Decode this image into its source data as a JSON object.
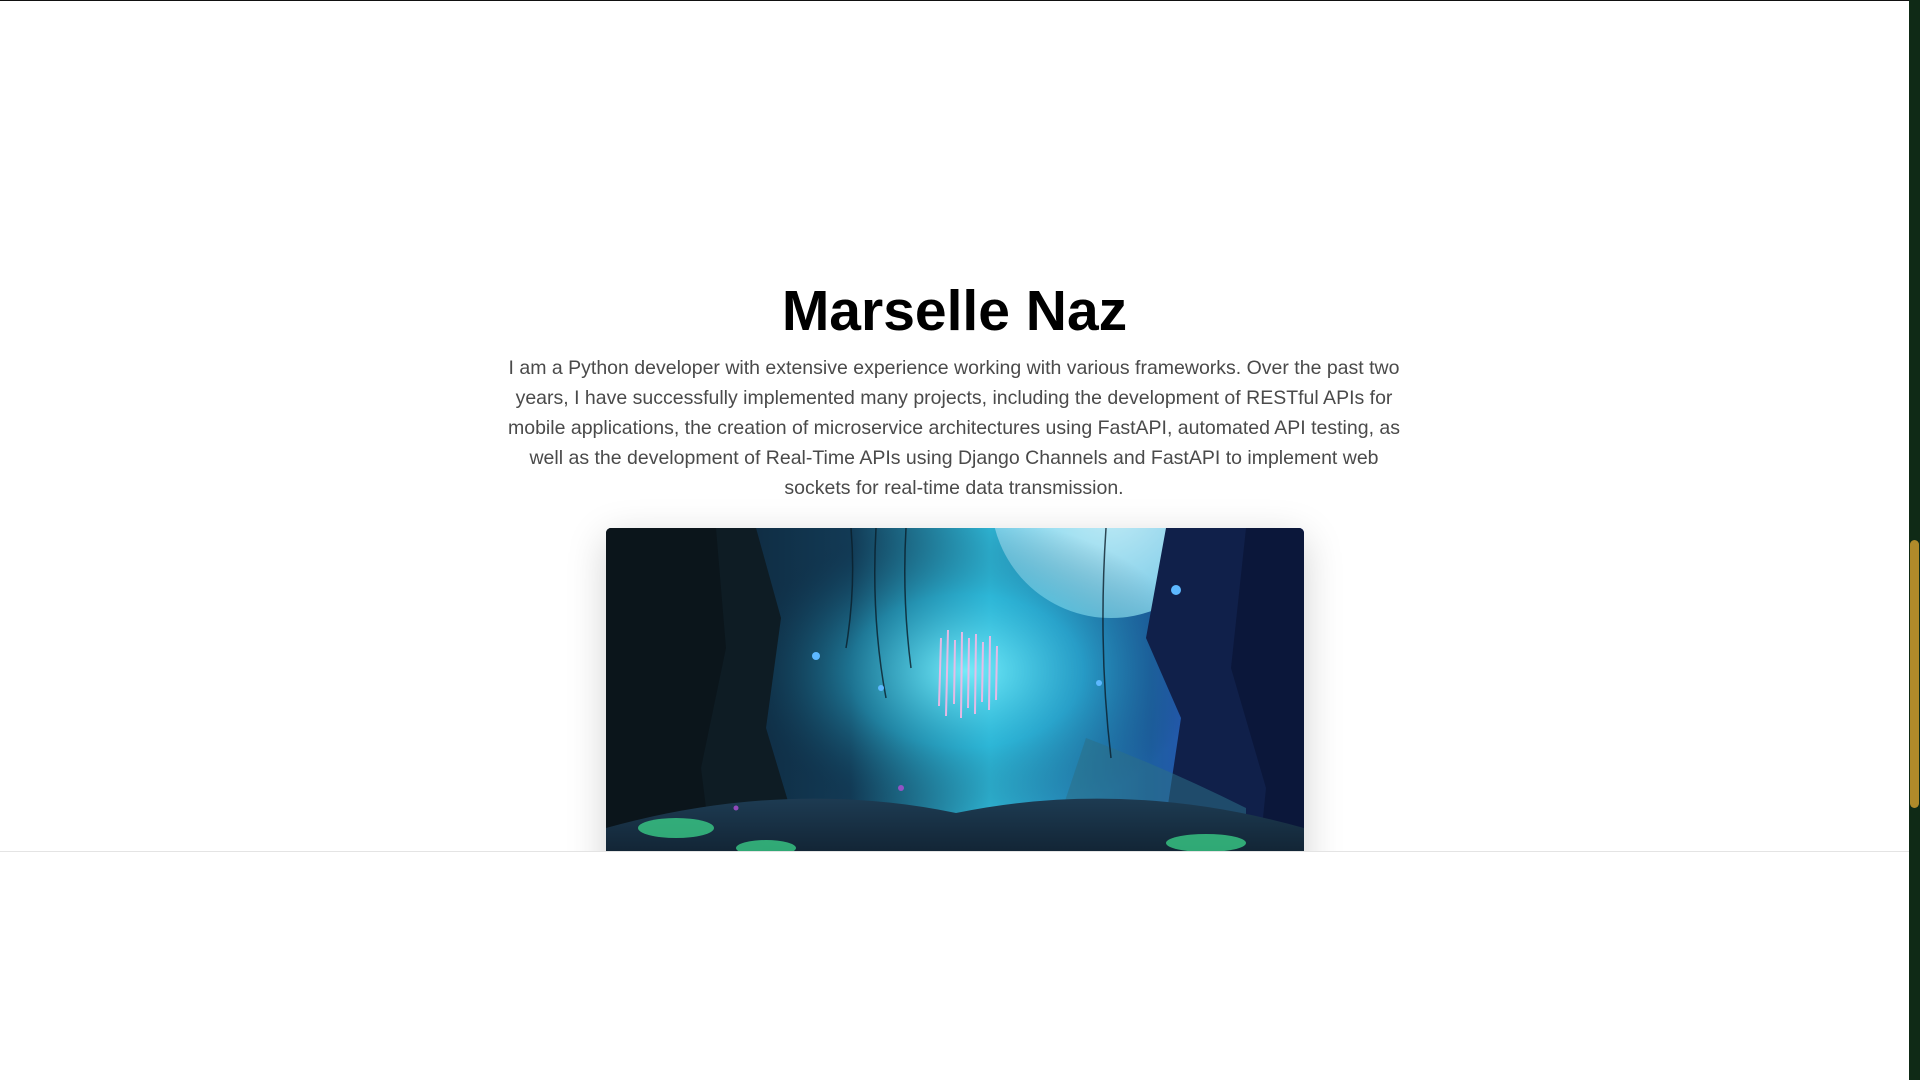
{
  "profile": {
    "name": "Marselle Naz",
    "bio": "I am a Python developer with extensive experience working with various frameworks. Over the past two years, I have successfully implemented many projects, including the development of RESTful APIs for mobile applications, the creation of microservice architectures using FastAPI, automated API testing, as well as the development of Real-Time APIs using Django Channels and FastAPI to implement web sockets for real-time data transmission."
  },
  "colors": {
    "heading": "#000000",
    "body_text": "#4a4a4a",
    "scrollbar_track": "#0f2a16",
    "scrollbar_thumb": "#b08a2a"
  }
}
